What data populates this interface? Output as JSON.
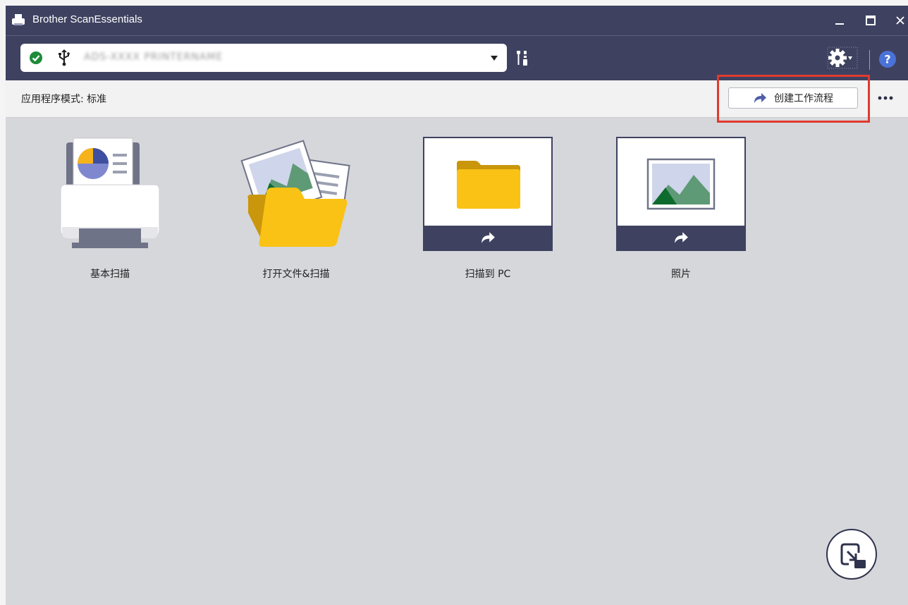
{
  "window": {
    "title": "Brother ScanEssentials",
    "controls": {
      "minimize": "minimize",
      "maximize": "maximize",
      "close": "close"
    }
  },
  "device_bar": {
    "status_icon": "check-circle-icon",
    "connection_icon": "usb-icon",
    "device_name": "ADS-XXXX PRINTERNAME",
    "dropdown_icon": "chevron-down-icon",
    "tools_icon": "tools-icon",
    "settings_icon": "gear-icon",
    "help_icon": "help-icon"
  },
  "mode_bar": {
    "mode_label": "应用程序模式: 标准",
    "create_workflow_label": "创建工作流程",
    "more_icon": "more-icon"
  },
  "tiles": [
    {
      "label": "基本扫描",
      "icon": "scanner-icon"
    },
    {
      "label": "打开文件&扫描",
      "icon": "open-file-folder-icon"
    },
    {
      "label": "扫描到 PC",
      "icon": "folder-icon"
    },
    {
      "label": "照片",
      "icon": "photo-icon"
    }
  ],
  "fab": {
    "icon": "switch-view-icon"
  },
  "colors": {
    "header": "#3e4260",
    "content_background": "#d6d7db",
    "accent_blue": "#4e5ea8",
    "folder_yellow": "#f9c215",
    "highlight_red": "#e03a2e"
  }
}
